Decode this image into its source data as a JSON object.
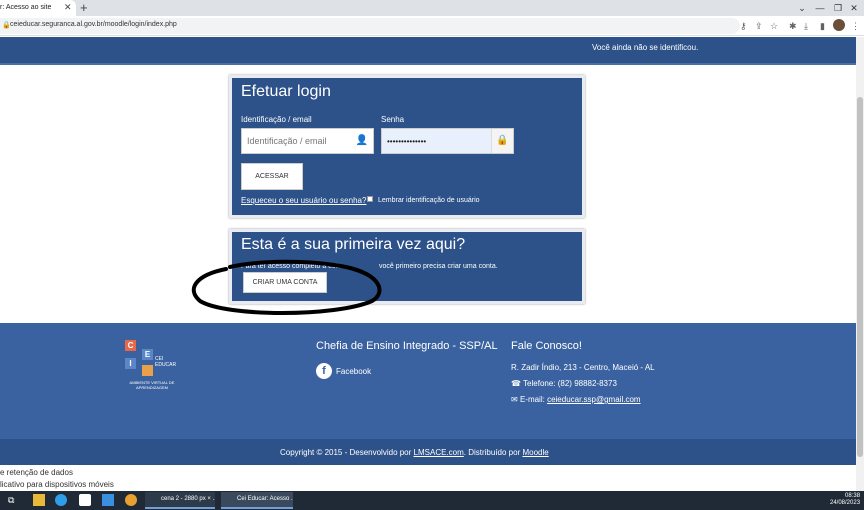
{
  "browser": {
    "tab_title": "r: Acesso ao site",
    "tab_close": "✕",
    "new_tab": "+",
    "url": "ceieducar.seguranca.al.gov.br/moodle/login/index.php"
  },
  "navbar": {
    "status": "Você ainda não se identificou."
  },
  "login": {
    "title": "Efetuar login",
    "username_label": "Identificação / email",
    "username_placeholder": "Identificação / email",
    "password_label": "Senha",
    "password_value": "••••••••••••••",
    "submit_label": "ACESSAR",
    "forgot_link": "Esqueceu o seu usuário ou senha?",
    "remember_label": "Lembrar identificação de usuário"
  },
  "register": {
    "title": "Esta é a sua primeira vez aqui?",
    "text_left": "Para ter acesso completo a este",
    "text_right": "você primeiro precisa criar uma conta.",
    "button_label": "CRIAR UMA CONTA"
  },
  "footer": {
    "logo_letters": [
      "C",
      "E",
      "I"
    ],
    "logo_sub1": "CEI",
    "logo_sub2": "EDUCAR",
    "logo_caption": "AMBIENTE VIRTUAL DE APRENDIZAGEM",
    "org_title": "Chefia de Ensino Integrado - SSP/AL",
    "facebook_label": "Facebook",
    "contact_title": "Fale Conosco!",
    "address": "R. Zadir Índio, 213 - Centro, Maceió - AL",
    "phone": "Telefone: (82) 98882-8373",
    "email_prefix": "E-mail: ",
    "email": "ceieducar.ssp@gmail.com",
    "copyright_prefix": "Copyright © 2015 - Desenvolvido por ",
    "developer": "LMSACE.com",
    "distributed_by": ". Distribuído por ",
    "moodle": "Moodle"
  },
  "bottom_links": [
    "e retenção de dados",
    "licativo para dispositivos móveis"
  ],
  "taskbar": {
    "window1": "cena 2 - 2880 px × ...",
    "window2": "Cei Educar: Acesso ...",
    "time": "08:38",
    "date": "24/08/2023"
  },
  "colors": {
    "brand_blue": "#2d5189",
    "footer_blue": "#3b62a0"
  }
}
